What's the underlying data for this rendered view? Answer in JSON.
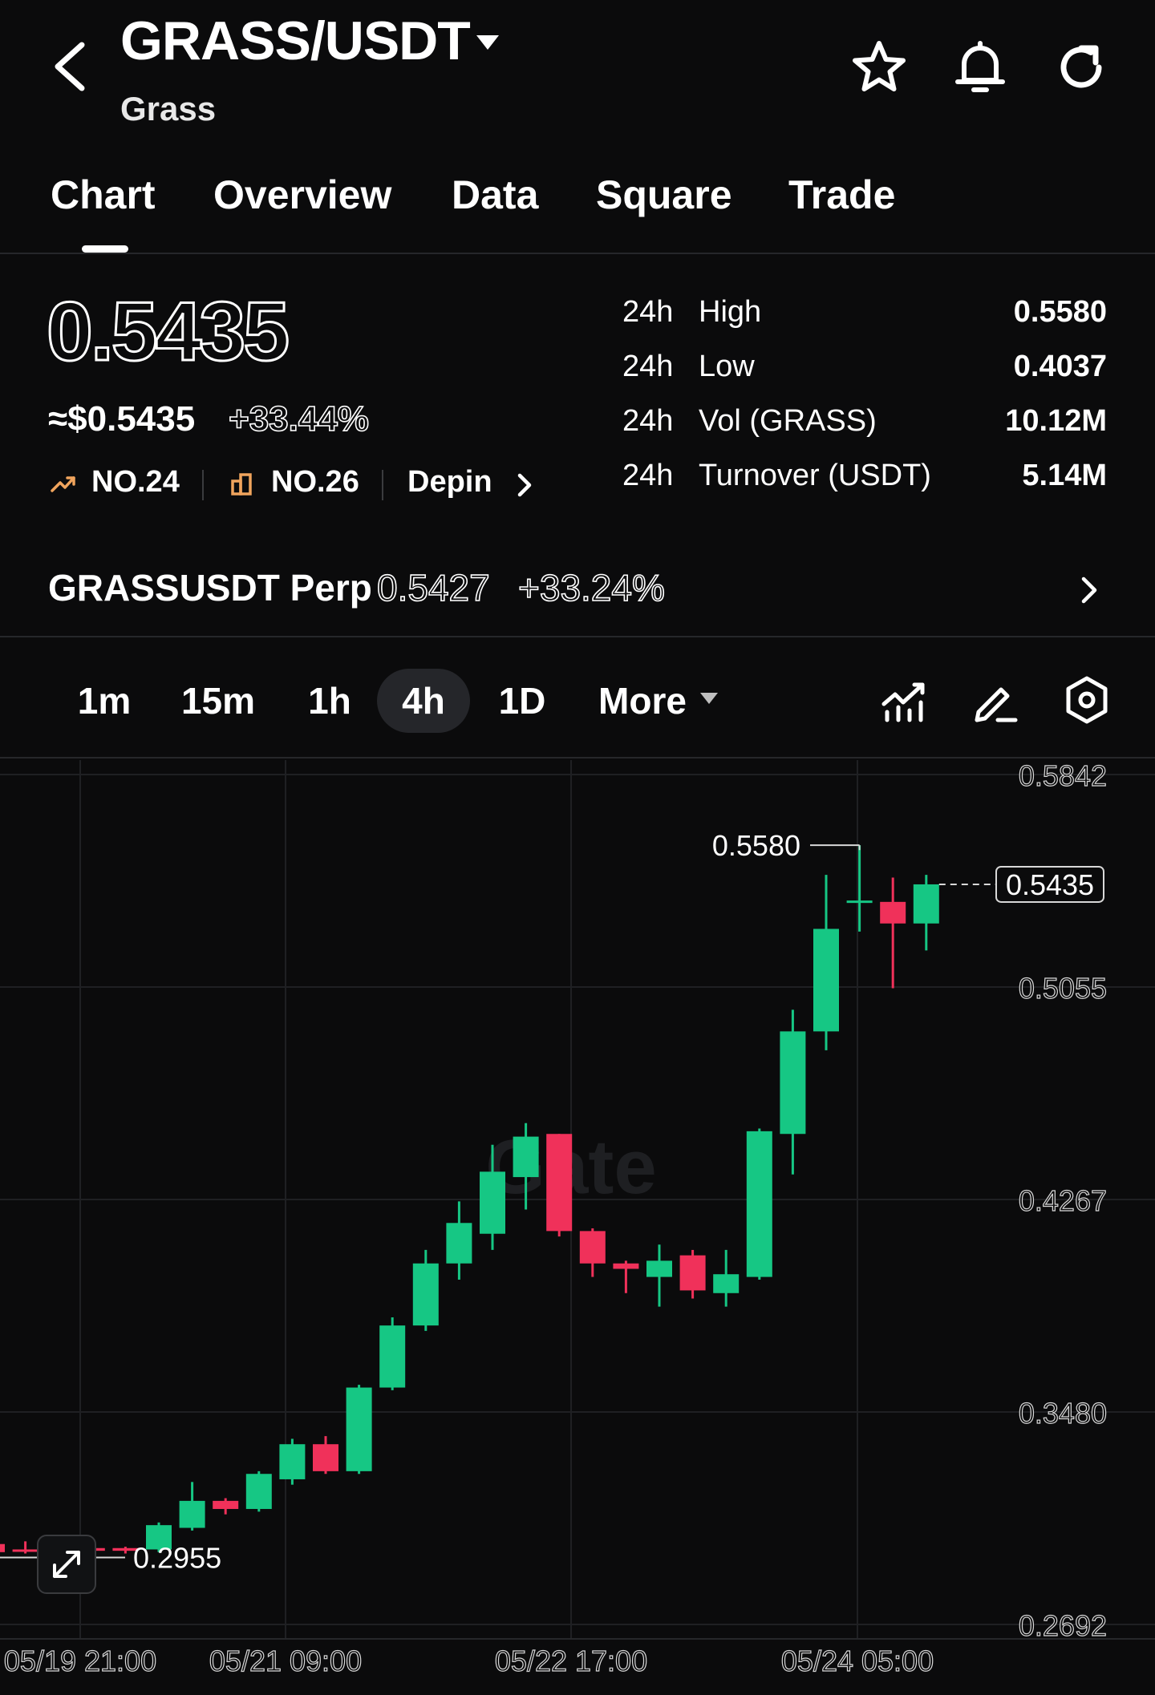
{
  "header": {
    "pair": "GRASS/USDT",
    "subtitle": "Grass",
    "icons": [
      "back-icon",
      "caret-down-icon",
      "star-icon",
      "bell-icon",
      "refresh-icon"
    ]
  },
  "tabs": [
    "Chart",
    "Overview",
    "Data",
    "Square",
    "Trade"
  ],
  "active_tab": "Chart",
  "price": {
    "last": "0.5435",
    "usd": "≈$0.5435",
    "change": "+33.44%",
    "rank_trending": "NO.24",
    "rank_volume": "NO.26",
    "sector": "Depin"
  },
  "stats": [
    {
      "period": "24h",
      "label": "High",
      "value": "0.5580"
    },
    {
      "period": "24h",
      "label": "Low",
      "value": "0.4037"
    },
    {
      "period": "24h",
      "label": "Vol (GRASS)",
      "value": "10.12M"
    },
    {
      "period": "24h",
      "label": "Turnover (USDT)",
      "value": "5.14M"
    }
  ],
  "perp": {
    "name": "GRASSUSDT Perp",
    "price": "0.5427",
    "change": "+33.24%"
  },
  "intervals": [
    "1m",
    "15m",
    "1h",
    "4h",
    "1D",
    "More"
  ],
  "active_interval": "4h",
  "colors": {
    "up": "#16c784",
    "down": "#f0315a",
    "background": "#0b0b0c",
    "grid": "#1f2023"
  },
  "chart_data": {
    "type": "candlestick",
    "watermark": "Gate",
    "y_ticks": [
      "0.5842",
      "0.5055",
      "0.4267",
      "0.3480",
      "0.2692"
    ],
    "ylim": [
      0.2692,
      0.5842
    ],
    "x_ticks": [
      "05/19 21:00",
      "05/21 09:00",
      "05/22 17:00",
      "05/24 05:00"
    ],
    "max_label": "0.5580",
    "min_label": "0.2955",
    "last_label": "0.5435",
    "candles": [
      {
        "o": 0.299,
        "c": 0.296,
        "h": 0.302,
        "l": 0.294
      },
      {
        "o": 0.297,
        "c": 0.2965,
        "h": 0.3,
        "l": 0.2955
      },
      {
        "o": 0.2965,
        "c": 0.2975,
        "h": 0.299,
        "l": 0.2955
      },
      {
        "o": 0.2975,
        "c": 0.2965,
        "h": 0.299,
        "l": 0.2955
      },
      {
        "o": 0.2975,
        "c": 0.2965,
        "h": 0.298,
        "l": 0.2955
      },
      {
        "o": 0.297,
        "c": 0.306,
        "h": 0.307,
        "l": 0.296
      },
      {
        "o": 0.305,
        "c": 0.315,
        "h": 0.322,
        "l": 0.304
      },
      {
        "o": 0.315,
        "c": 0.312,
        "h": 0.316,
        "l": 0.31
      },
      {
        "o": 0.312,
        "c": 0.325,
        "h": 0.326,
        "l": 0.311
      },
      {
        "o": 0.323,
        "c": 0.336,
        "h": 0.338,
        "l": 0.321
      },
      {
        "o": 0.336,
        "c": 0.326,
        "h": 0.339,
        "l": 0.325
      },
      {
        "o": 0.326,
        "c": 0.357,
        "h": 0.358,
        "l": 0.325
      },
      {
        "o": 0.357,
        "c": 0.38,
        "h": 0.383,
        "l": 0.356
      },
      {
        "o": 0.38,
        "c": 0.403,
        "h": 0.408,
        "l": 0.378
      },
      {
        "o": 0.403,
        "c": 0.418,
        "h": 0.426,
        "l": 0.397
      },
      {
        "o": 0.414,
        "c": 0.437,
        "h": 0.447,
        "l": 0.408
      },
      {
        "o": 0.435,
        "c": 0.45,
        "h": 0.455,
        "l": 0.423
      },
      {
        "o": 0.451,
        "c": 0.415,
        "h": 0.451,
        "l": 0.413
      },
      {
        "o": 0.415,
        "c": 0.403,
        "h": 0.416,
        "l": 0.398
      },
      {
        "o": 0.403,
        "c": 0.401,
        "h": 0.404,
        "l": 0.392
      },
      {
        "o": 0.398,
        "c": 0.404,
        "h": 0.41,
        "l": 0.387
      },
      {
        "o": 0.406,
        "c": 0.393,
        "h": 0.408,
        "l": 0.39
      },
      {
        "o": 0.392,
        "c": 0.399,
        "h": 0.408,
        "l": 0.387
      },
      {
        "o": 0.398,
        "c": 0.452,
        "h": 0.453,
        "l": 0.397
      },
      {
        "o": 0.451,
        "c": 0.489,
        "h": 0.497,
        "l": 0.436
      },
      {
        "o": 0.489,
        "c": 0.527,
        "h": 0.547,
        "l": 0.482
      },
      {
        "o": 0.537,
        "c": 0.5375,
        "h": 0.558,
        "l": 0.526
      },
      {
        "o": 0.537,
        "c": 0.529,
        "h": 0.546,
        "l": 0.505
      },
      {
        "o": 0.529,
        "c": 0.5435,
        "h": 0.547,
        "l": 0.519
      }
    ]
  }
}
